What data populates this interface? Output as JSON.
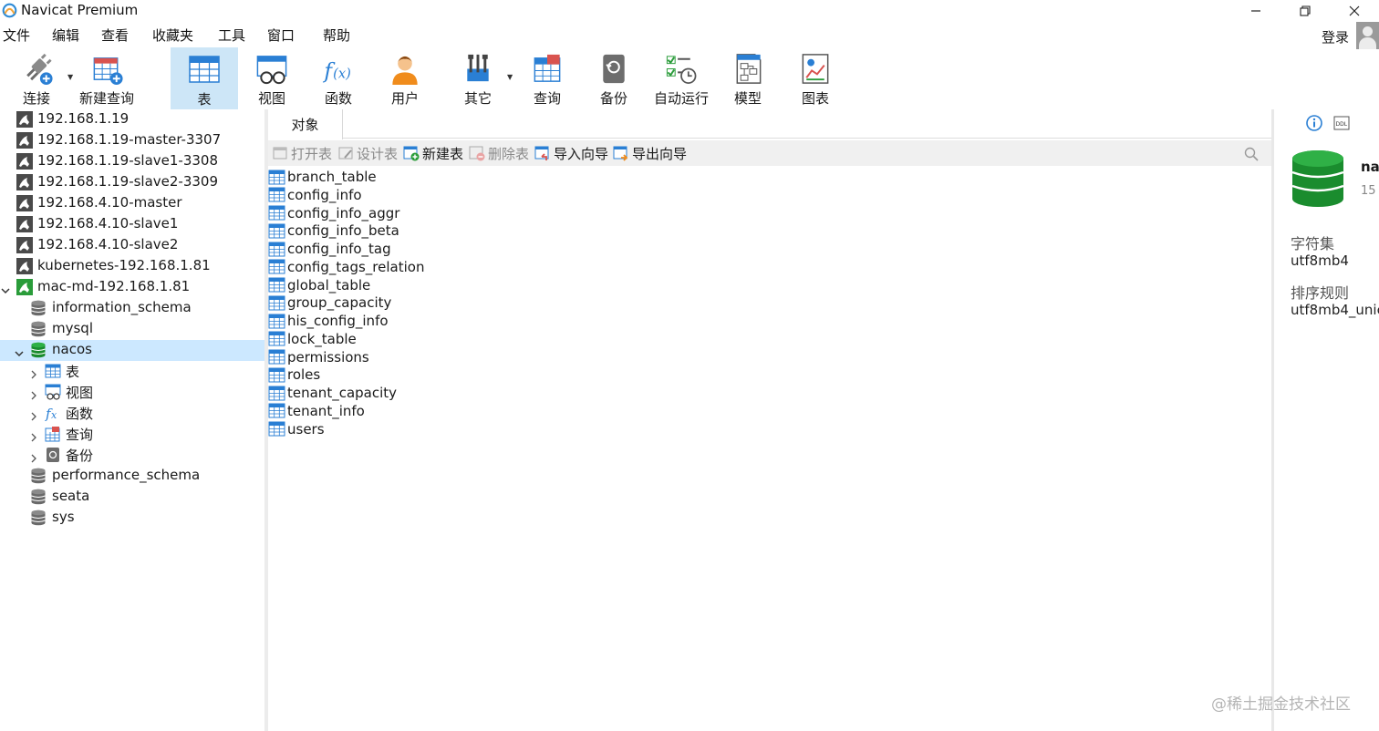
{
  "window": {
    "title": "Navicat Premium"
  },
  "menu": [
    "文件",
    "编辑",
    "查看",
    "收藏夹",
    "工具",
    "窗口",
    "帮助"
  ],
  "login_label": "登录",
  "toolbar": {
    "connect": "连接",
    "new_query": "新建查询",
    "table": "表",
    "view": "视图",
    "function": "函数",
    "user": "用户",
    "other": "其它",
    "query": "查询",
    "backup": "备份",
    "automation": "自动运行",
    "model": "模型",
    "chart": "图表"
  },
  "tree": {
    "connections": [
      "192.168.1.19",
      "192.168.1.19-master-3307",
      "192.168.1.19-slave1-3308",
      "192.168.1.19-slave2-3309",
      "192.168.4.10-master",
      "192.168.4.10-slave1",
      "192.168.4.10-slave2",
      "kubernetes-192.168.1.81",
      "mac-md-192.168.1.81"
    ],
    "databases": [
      "information_schema",
      "mysql",
      "nacos",
      "performance_schema",
      "seata",
      "sys"
    ],
    "nacos_children": [
      "表",
      "视图",
      "函数",
      "查询",
      "备份"
    ]
  },
  "main": {
    "tab": "对象",
    "actions": {
      "open": "打开表",
      "design": "设计表",
      "new": "新建表",
      "delete": "删除表",
      "import": "导入向导",
      "export": "导出向导"
    },
    "tables": [
      "branch_table",
      "config_info",
      "config_info_aggr",
      "config_info_beta",
      "config_info_tag",
      "config_tags_relation",
      "global_table",
      "group_capacity",
      "his_config_info",
      "lock_table",
      "permissions",
      "roles",
      "tenant_capacity",
      "tenant_info",
      "users"
    ]
  },
  "info": {
    "name_partial": "na",
    "count_partial": "15",
    "charset_label": "字符集",
    "charset_value": "utf8mb4",
    "collation_label": "排序规则",
    "collation_value": "utf8mb4_unic"
  },
  "watermark": "@稀土掘金技术社区",
  "colors": {
    "accent": "#2a7fd4",
    "selection": "#cce8ff",
    "toolbar_active": "#cde6f7",
    "db_green": "#1a9c3a"
  }
}
